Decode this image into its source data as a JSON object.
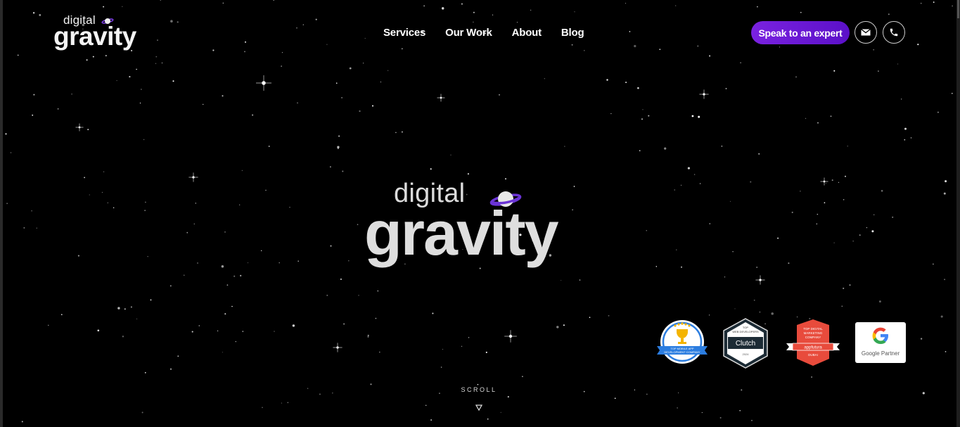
{
  "brand": {
    "logo_top": "digital",
    "logo_bottom": "gravity"
  },
  "nav": {
    "items": [
      "Services",
      "Our Work",
      "About",
      "Blog"
    ]
  },
  "header": {
    "cta_label": "Speak to an expert",
    "email_icon": "envelope-icon",
    "phone_icon": "phone-icon"
  },
  "hero": {
    "logo_top": "digital",
    "logo_bottom": "gravity"
  },
  "badges": [
    {
      "name": "top-mobile-app-development-company",
      "lines": [
        "TOP MOBILE APP",
        "DEVELOPMENT COMPANY"
      ]
    },
    {
      "name": "clutch-top-web-developers",
      "top": "TOP",
      "subtitle": "WEB DEVELOPERS",
      "brand": "Clutch",
      "year": "2024"
    },
    {
      "name": "appfutura-top-digital-marketing",
      "lines": [
        "TOP DIGITAL",
        "MARKETING",
        "COMPANY"
      ],
      "brand": "appfutura",
      "city": "DUBAI"
    },
    {
      "name": "google-partner",
      "label": "Google Partner"
    }
  ],
  "scroll": {
    "label": "SCROLL"
  },
  "colors": {
    "background": "#000000",
    "accent": "#6a1bd8",
    "planet": "#7a3ee0"
  }
}
